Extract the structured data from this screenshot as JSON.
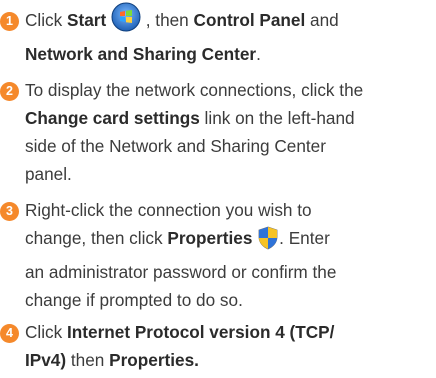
{
  "steps": [
    {
      "number": "1",
      "line1": {
        "a": "Click ",
        "b_start": "Start",
        "c": " , then ",
        "d_cp": "Control Panel",
        "e": " and"
      },
      "line2": {
        "b_nsc": "Network and Sharing Center",
        "c": "."
      },
      "icon": "windows-start-orb-icon"
    },
    {
      "number": "2",
      "line1": "To display the network connections, click the",
      "line2": {
        "b": "Change card settings",
        "c": " link on the left-hand"
      },
      "line3": "side of the Network and Sharing Center",
      "line4": "panel."
    },
    {
      "number": "3",
      "line1": "Right-click the connection you wish to",
      "line2": {
        "a": "change, then click ",
        "b": "Properties",
        "c": ". Enter"
      },
      "line3": "an administrator password or confirm the",
      "line4": "change if prompted to do so.",
      "icon": "uac-shield-icon"
    },
    {
      "number": "4",
      "line1": {
        "a": "Click ",
        "b": "Internet Protocol version 4 (TCP/"
      },
      "line2": {
        "b": "IPv4)",
        "c": " then ",
        "d": "Properties."
      }
    }
  ],
  "colors": {
    "accent": "#f5892b",
    "text": "#3c3c3c"
  }
}
